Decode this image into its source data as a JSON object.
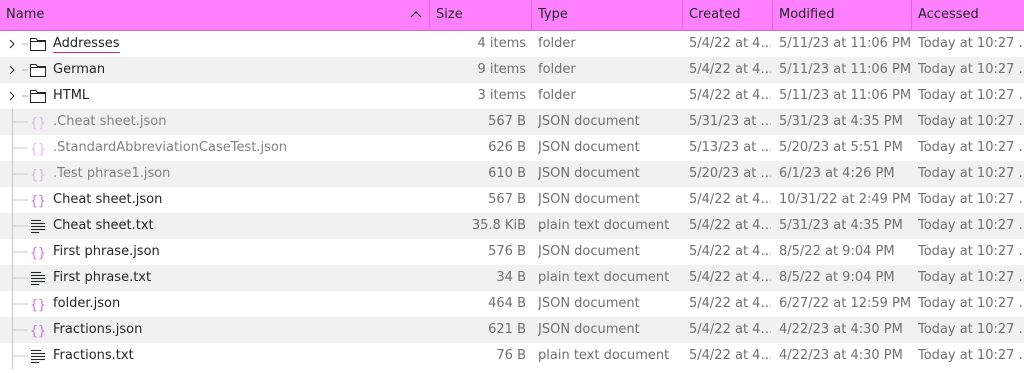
{
  "columns": {
    "name": "Name",
    "size": "Size",
    "type": "Type",
    "created": "Created",
    "modified": "Modified",
    "accessed": "Accessed"
  },
  "colors": {
    "header_bg": "#ff80ff",
    "json_icon": "#c678dd",
    "underline": "#d4287a"
  },
  "rows": [
    {
      "name": "Addresses",
      "size": "4 items",
      "type": "folder",
      "created": "5/4/22 at 4…",
      "modified": "5/11/23 at 11:06 PM",
      "accessed": "Today at 10:27 …",
      "icon": "folder-icon"
    },
    {
      "name": "German",
      "size": "9 items",
      "type": "folder",
      "created": "5/4/22 at 4…",
      "modified": "5/11/23 at 11:06 PM",
      "accessed": "Today at 10:27 …",
      "icon": "folder-icon"
    },
    {
      "name": "HTML",
      "size": "3 items",
      "type": "folder",
      "created": "5/4/22 at 4…",
      "modified": "5/11/23 at 11:06 PM",
      "accessed": "Today at 10:27 …",
      "icon": "folder-icon"
    },
    {
      "name": ".Cheat sheet.json",
      "size": "567 B",
      "type": "JSON document",
      "created": "5/31/23 at …",
      "modified": "5/31/23 at 4:35 PM",
      "accessed": "Today at 10:27 …",
      "icon": "json-icon"
    },
    {
      "name": ".StandardAbbreviationCaseTest.json",
      "size": "626 B",
      "type": "JSON document",
      "created": "5/13/23 at …",
      "modified": "5/20/23 at 5:51 PM",
      "accessed": "Today at 10:27 …",
      "icon": "json-icon"
    },
    {
      "name": ".Test phrase1.json",
      "size": "610 B",
      "type": "JSON document",
      "created": "5/20/23 at …",
      "modified": "6/1/23 at 4:26 PM",
      "accessed": "Today at 10:27 …",
      "icon": "json-icon"
    },
    {
      "name": "Cheat sheet.json",
      "size": "567 B",
      "type": "JSON document",
      "created": "5/4/22 at 4…",
      "modified": "10/31/22 at 2:49 PM",
      "accessed": "Today at 10:27 …",
      "icon": "json-icon"
    },
    {
      "name": "Cheat sheet.txt",
      "size": "35.8 KiB",
      "type": "plain text document",
      "created": "5/4/22 at 4…",
      "modified": "5/31/23 at 4:35 PM",
      "accessed": "Today at 10:27 …",
      "icon": "text-file-icon"
    },
    {
      "name": "First phrase.json",
      "size": "576 B",
      "type": "JSON document",
      "created": "5/4/22 at 4…",
      "modified": "8/5/22 at 9:04 PM",
      "accessed": "Today at 10:27 …",
      "icon": "json-icon"
    },
    {
      "name": "First phrase.txt",
      "size": "34 B",
      "type": "plain text document",
      "created": "5/4/22 at 4…",
      "modified": "8/5/22 at 9:04 PM",
      "accessed": "Today at 10:27 …",
      "icon": "text-file-icon"
    },
    {
      "name": "folder.json",
      "size": "464 B",
      "type": "JSON document",
      "created": "5/4/22 at 4…",
      "modified": "6/27/22 at 12:59 PM",
      "accessed": "Today at 10:27 …",
      "icon": "json-icon"
    },
    {
      "name": "Fractions.json",
      "size": "621 B",
      "type": "JSON document",
      "created": "5/4/22 at 4…",
      "modified": "4/22/23 at 4:30 PM",
      "accessed": "Today at 10:27 …",
      "icon": "json-icon"
    },
    {
      "name": "Fractions.txt",
      "size": "76 B",
      "type": "plain text document",
      "created": "5/4/22 at 4…",
      "modified": "4/22/23 at 4:30 PM",
      "accessed": "Today at 10:27 …",
      "icon": "text-file-icon"
    }
  ]
}
